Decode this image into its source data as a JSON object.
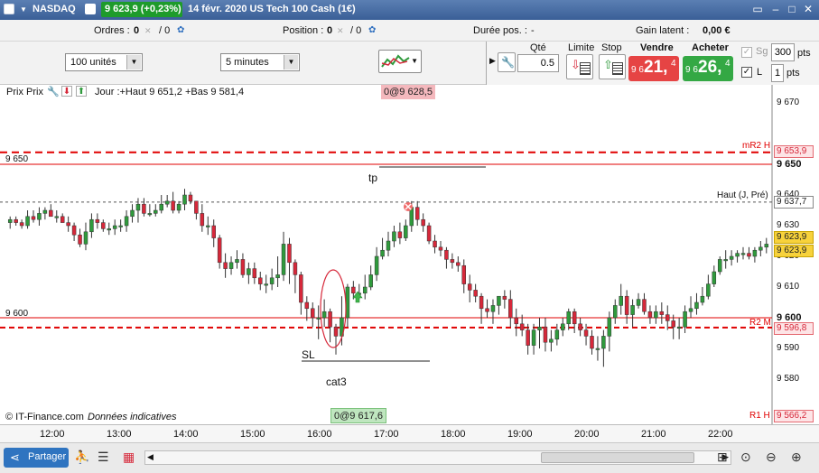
{
  "titlebar": {
    "instrument": "NASDAQ",
    "price_badge": "9 623,9 (+0,23%)",
    "description": "14 févr. 2020 US Tech 100 Cash (1€)"
  },
  "positions_bar": {
    "orders_label": "Ordres :",
    "orders_count": "0",
    "orders_slash": "/ 0",
    "position_label": "Position :",
    "position_count": "0",
    "position_slash": "/ 0",
    "duration_label": "Durée pos. :",
    "duration_value": "-",
    "gain_label": "Gain latent :",
    "gain_value": "0,00 €"
  },
  "toolbar": {
    "units_select": "100 unités",
    "interval_select": "5 minutes"
  },
  "order_panel": {
    "qty_label": "Qté",
    "qty_value": "0.5",
    "limit_label": "Limite",
    "stop_label": "Stop",
    "sell_label": "Vendre",
    "sell_prefix": "9 6",
    "sell_big": "21,",
    "sell_sup": "4",
    "buy_label": "Acheter",
    "buy_prefix": "9 6",
    "buy_big": "26,",
    "buy_sup": "4",
    "sg_label": "Sg",
    "sg_value": "300",
    "pts_label": "pts",
    "l_label": "L",
    "l_value": "1",
    "pts2_label": "pts"
  },
  "chart_header": {
    "title": "Prix Prix",
    "ohlc": "Jour :+Haut 9 651,2 +Bas 9 581,4",
    "top_tag": "0@9 628,5"
  },
  "chart_labels": {
    "line_9650": "9 650",
    "line_9600": "9 600",
    "tp": "tp",
    "sl": "SL",
    "cat3": "cat3",
    "mr2": "mR2 H",
    "haut": "Haut (J, Pré)",
    "r2": "R2 M",
    "r1": "R1 H",
    "footer": "© IT-Finance.com",
    "footer_italic": "Données indicatives",
    "bottom_tag": "0@9 617,6"
  },
  "price_axis": {
    "ticks": [
      "9 670",
      "9 650",
      "9 640",
      "9 630",
      "9 620",
      "9 610",
      "9 600",
      "9 590",
      "9 580"
    ],
    "tag_mr2": "9 653,9",
    "tag_haut": "9 637,7",
    "tag_current1": "9 623,9",
    "tag_current2": "9 623,9",
    "tag_r2": "9 596,8",
    "tag_r1": "9 566,2"
  },
  "time_axis": {
    "ticks": [
      "12:00",
      "13:00",
      "14:00",
      "15:00",
      "16:00",
      "17:00",
      "18:00",
      "19:00",
      "20:00",
      "21:00",
      "22:00"
    ]
  },
  "bottom_bar": {
    "share_label": "Partager"
  },
  "chart_data": {
    "type": "candlestick",
    "x": [
      "11:40",
      "11:45",
      "11:50",
      "11:55",
      "12:00",
      "12:05",
      "12:10",
      "12:15",
      "12:20",
      "12:25",
      "12:30",
      "12:35",
      "12:40",
      "12:45",
      "12:50",
      "12:55",
      "13:00",
      "13:05",
      "13:10",
      "13:15",
      "13:20",
      "13:25",
      "13:30",
      "13:35",
      "13:40",
      "13:45",
      "13:50",
      "13:55",
      "14:00",
      "14:05",
      "14:10",
      "14:15",
      "14:20",
      "14:25",
      "14:30",
      "14:35",
      "14:40",
      "14:45",
      "14:50",
      "14:55",
      "15:00",
      "15:05",
      "15:10",
      "15:15",
      "15:20",
      "15:25",
      "15:30",
      "15:35",
      "15:40",
      "15:45",
      "15:50",
      "15:55",
      "16:00",
      "16:05",
      "16:10",
      "16:15",
      "16:20",
      "16:25",
      "16:30",
      "16:35",
      "16:40",
      "16:45",
      "16:50",
      "16:55",
      "17:00",
      "17:05",
      "17:10",
      "17:15",
      "17:20",
      "17:25",
      "17:30",
      "17:35",
      "17:40",
      "17:45",
      "17:50",
      "17:55",
      "18:00",
      "18:05",
      "18:10",
      "18:15",
      "18:20",
      "18:25",
      "18:30",
      "18:35",
      "18:40",
      "18:45",
      "18:50",
      "18:55",
      "19:00",
      "19:05",
      "19:10",
      "19:15",
      "19:20",
      "19:25",
      "19:30",
      "19:35",
      "19:40",
      "19:45",
      "19:50",
      "19:55",
      "20:00",
      "20:05",
      "20:10",
      "20:15",
      "20:20",
      "20:25",
      "20:30",
      "20:35",
      "20:40",
      "20:45",
      "20:50",
      "20:55",
      "21:00",
      "21:05",
      "21:10",
      "21:15",
      "21:20",
      "21:25",
      "21:30",
      "21:35",
      "21:40",
      "21:45",
      "21:50",
      "21:55",
      "22:00",
      "22:05",
      "22:10",
      "22:15",
      "22:20",
      "22:25",
      "22:30"
    ],
    "open": [
      9631,
      9632,
      9631,
      9630,
      9633,
      9632,
      9634,
      9635,
      9633,
      9633,
      9631,
      9630,
      9627,
      9624,
      9628,
      9632,
      9631,
      9629,
      9629,
      9630,
      9630,
      9633,
      9635,
      9637,
      9634,
      9634,
      9635,
      9637,
      9638,
      9635,
      9637,
      9640,
      9638,
      9634,
      9630,
      9630,
      9626,
      9618,
      9616,
      9618,
      9619,
      9614,
      9616,
      9613,
      9611,
      9611,
      9613,
      9614,
      9624,
      9618,
      9614,
      9605,
      9603,
      9600,
      9600,
      9602,
      9597,
      9594,
      9600,
      9610,
      9608,
      9608,
      9610,
      9614,
      9620,
      9622,
      9625,
      9628,
      9626,
      9630,
      9636,
      9632,
      9630,
      9625,
      9623,
      9622,
      9619,
      9618,
      9617,
      9611,
      9609,
      9607,
      9603,
      9602,
      9604,
      9607,
      9606,
      9600,
      9598,
      9596,
      9591,
      9596,
      9597,
      9592,
      9593,
      9596,
      9598,
      9602,
      9598,
      9596,
      9594,
      9590,
      9590,
      9594,
      9600,
      9604,
      9607,
      9601,
      9604,
      9606,
      9602,
      9600,
      9602,
      9601,
      9599,
      9597,
      9597,
      9602,
      9603,
      9605,
      9607,
      9611,
      9615,
      9619,
      9619,
      9620,
      9621,
      9621,
      9620,
      9622,
      9623
    ],
    "high": [
      9633,
      9633,
      9632,
      9635,
      9635,
      9636,
      9636,
      9637,
      9635,
      9634,
      9633,
      9631,
      9629,
      9631,
      9634,
      9634,
      9632,
      9631,
      9632,
      9632,
      9635,
      9637,
      9639,
      9639,
      9637,
      9637,
      9640,
      9640,
      9641,
      9638,
      9642,
      9641,
      9638,
      9637,
      9633,
      9632,
      9627,
      9621,
      9620,
      9622,
      9621,
      9618,
      9618,
      9615,
      9614,
      9616,
      9620,
      9628,
      9626,
      9619,
      9615,
      9607,
      9605,
      9604,
      9606,
      9603,
      9598,
      9607,
      9611,
      9612,
      9611,
      9614,
      9617,
      9623,
      9626,
      9628,
      9630,
      9631,
      9632,
      9638,
      9638,
      9634,
      9631,
      9627,
      9625,
      9623,
      9621,
      9620,
      9619,
      9614,
      9611,
      9608,
      9606,
      9606,
      9607,
      9609,
      9609,
      9603,
      9601,
      9598,
      9598,
      9600,
      9600,
      9596,
      9598,
      9600,
      9603,
      9603,
      9600,
      9598,
      9596,
      9594,
      9596,
      9602,
      9606,
      9611,
      9609,
      9606,
      9608,
      9608,
      9604,
      9604,
      9605,
      9604,
      9601,
      9600,
      9604,
      9607,
      9608,
      9610,
      9614,
      9617,
      9620,
      9622,
      9622,
      9622,
      9623,
      9623,
      9623,
      9625,
      9626
    ],
    "low": [
      9629,
      9630,
      9629,
      9629,
      9631,
      9630,
      9632,
      9633,
      9631,
      9631,
      9628,
      9625,
      9623,
      9622,
      9626,
      9629,
      9628,
      9627,
      9627,
      9628,
      9628,
      9631,
      9631,
      9633,
      9633,
      9633,
      9634,
      9636,
      9634,
      9634,
      9635,
      9637,
      9632,
      9628,
      9627,
      9623,
      9616,
      9613,
      9614,
      9616,
      9613,
      9611,
      9611,
      9609,
      9608,
      9609,
      9610,
      9612,
      9611,
      9608,
      9601,
      9599,
      9597,
      9593,
      9597,
      9592,
      9588,
      9591,
      9597,
      9606,
      9606,
      9606,
      9609,
      9612,
      9619,
      9620,
      9623,
      9624,
      9625,
      9628,
      9630,
      9628,
      9624,
      9621,
      9620,
      9616,
      9616,
      9615,
      9608,
      9605,
      9605,
      9598,
      9600,
      9598,
      9601,
      9603,
      9597,
      9594,
      9594,
      9588,
      9588,
      9590,
      9589,
      9589,
      9591,
      9594,
      9596,
      9595,
      9594,
      9591,
      9588,
      9586,
      9584,
      9589,
      9598,
      9601,
      9598,
      9597,
      9603,
      9601,
      9598,
      9598,
      9598,
      9596,
      9593,
      9593,
      9595,
      9600,
      9601,
      9604,
      9606,
      9610,
      9614,
      9616,
      9617,
      9618,
      9619,
      9619,
      9618,
      9620,
      9621
    ],
    "close": [
      9632,
      9631,
      9630,
      9633,
      9632,
      9634,
      9635,
      9633,
      9633,
      9631,
      9630,
      9627,
      9624,
      9628,
      9632,
      9631,
      9629,
      9629,
      9630,
      9630,
      9633,
      9635,
      9637,
      9634,
      9634,
      9635,
      9637,
      9638,
      9635,
      9637,
      9640,
      9638,
      9634,
      9630,
      9630,
      9626,
      9618,
      9616,
      9618,
      9619,
      9614,
      9616,
      9613,
      9611,
      9611,
      9613,
      9614,
      9624,
      9618,
      9614,
      9605,
      9603,
      9600,
      9600,
      9602,
      9597,
      9594,
      9600,
      9610,
      9608,
      9608,
      9610,
      9614,
      9620,
      9622,
      9625,
      9628,
      9626,
      9630,
      9636,
      9632,
      9630,
      9625,
      9623,
      9622,
      9619,
      9618,
      9617,
      9611,
      9609,
      9607,
      9603,
      9602,
      9604,
      9607,
      9606,
      9600,
      9598,
      9596,
      9591,
      9596,
      9597,
      9592,
      9593,
      9596,
      9598,
      9602,
      9598,
      9596,
      9594,
      9590,
      9590,
      9594,
      9600,
      9604,
      9607,
      9601,
      9604,
      9606,
      9602,
      9600,
      9602,
      9601,
      9599,
      9597,
      9597,
      9602,
      9603,
      9605,
      9607,
      9611,
      9615,
      9619,
      9619,
      9620,
      9621,
      9621,
      9620,
      9622,
      9623,
      9624
    ],
    "ylim": [
      9570,
      9678
    ],
    "xlabel": "",
    "ylabel": "",
    "levels": [
      {
        "name": "mR2 H",
        "value": 9653.9
      },
      {
        "name": "9 650",
        "value": 9650
      },
      {
        "name": "Haut (J, Pré)",
        "value": 9637.7
      },
      {
        "name": "9 600",
        "value": 9600
      },
      {
        "name": "R2 M",
        "value": 9596.8
      }
    ],
    "legend": "none",
    "grid": false,
    "colors": {
      "up": "#2f9a3c",
      "down": "#d6283a",
      "mr2": "#e00000",
      "haut": "#555555"
    }
  }
}
